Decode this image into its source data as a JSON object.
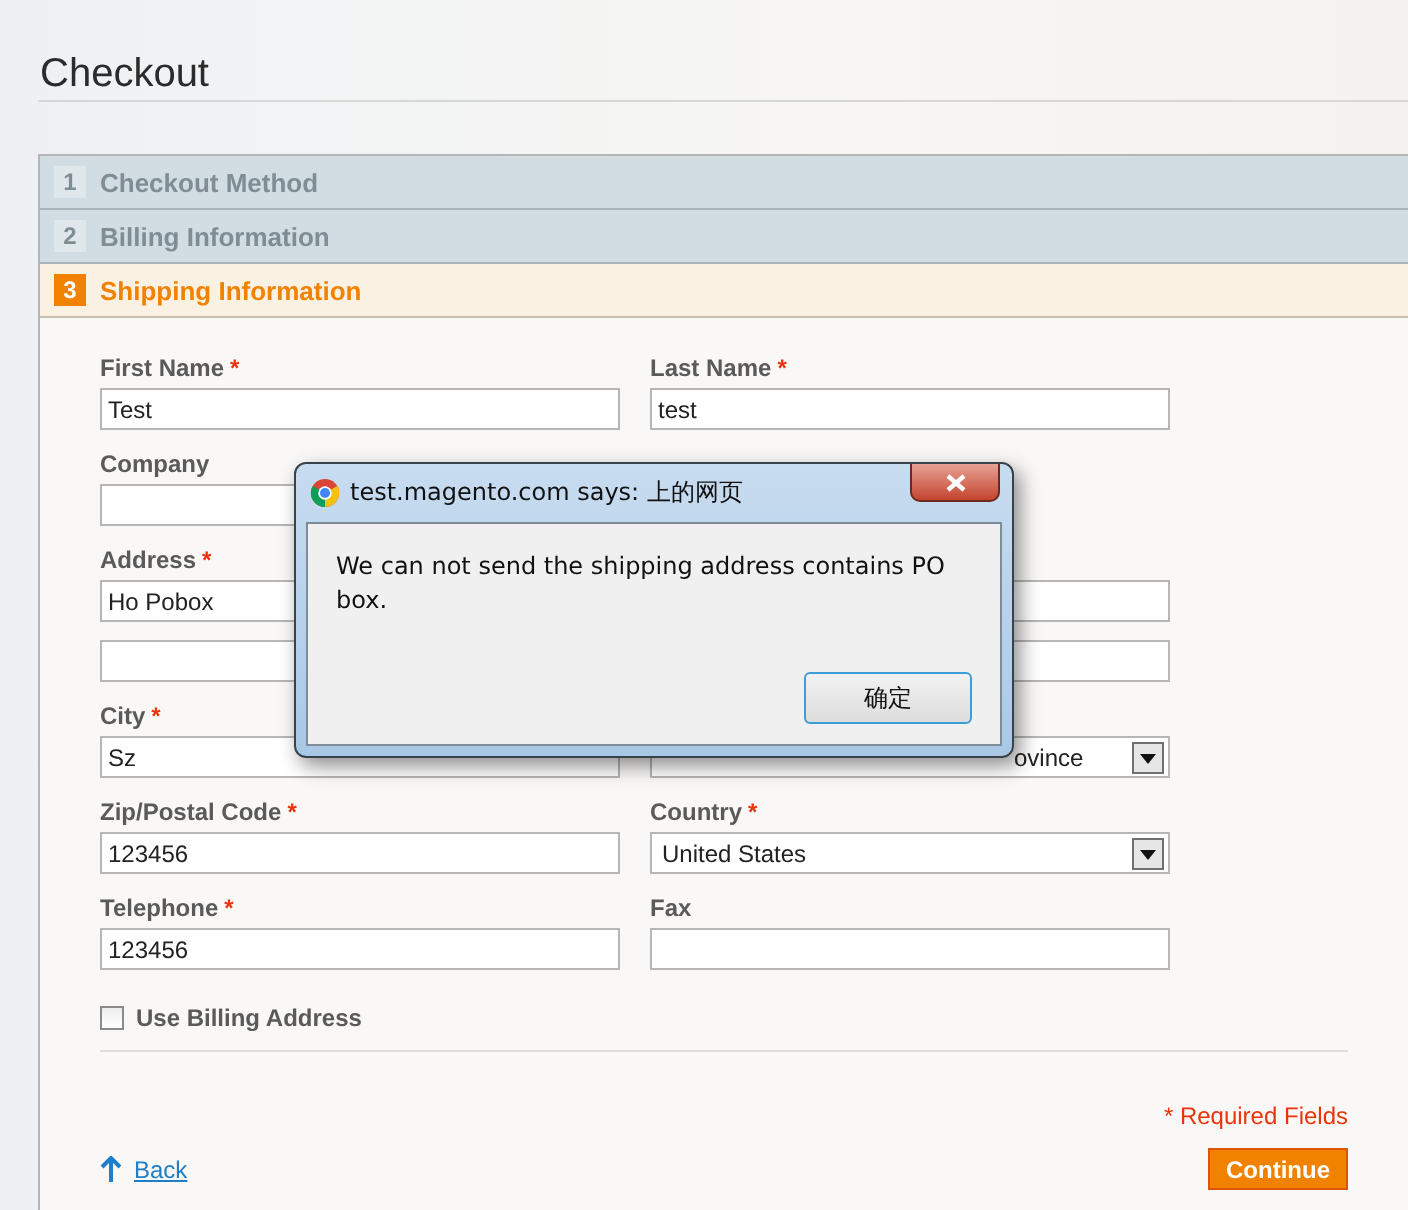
{
  "page": {
    "title": "Checkout"
  },
  "steps": [
    {
      "number": "1",
      "title": "Checkout Method",
      "selected": false
    },
    {
      "number": "2",
      "title": "Billing Information",
      "selected": false
    },
    {
      "number": "3",
      "title": "Shipping Information",
      "selected": true
    }
  ],
  "form": {
    "fields": [
      {
        "kind": "text",
        "label": "First Name",
        "required_mark": "*",
        "value": "Test"
      },
      {
        "kind": "text",
        "label": "Last Name",
        "required_mark": "*",
        "value": "test"
      },
      {
        "kind": "text",
        "label": "Company"
      },
      {
        "kind": "address",
        "label": "Address",
        "required_mark": "*",
        "value": "Ho Pobox"
      },
      {
        "kind": "text",
        "label": "City",
        "required_mark": "*",
        "value": "Sz"
      },
      {
        "kind": "select",
        "value": "ovince"
      },
      {
        "kind": "text",
        "label": "Zip/Postal Code",
        "required_mark": "*",
        "value": "123456"
      },
      {
        "kind": "select",
        "label": "Country",
        "required_mark": "*",
        "value": "United States"
      },
      {
        "kind": "text",
        "label": "Telephone",
        "required_mark": "*",
        "value": "123456"
      },
      {
        "kind": "text",
        "label": "Fax"
      }
    ],
    "use_billing_address": {
      "label": "Use Billing Address",
      "checked": false
    },
    "required_note": "* Required Fields",
    "back_link": "Back",
    "continue_button": "Continue"
  },
  "dialog": {
    "title": "test.magento.com says: 上的网页",
    "message": "We can not send the shipping address contains PO box.",
    "ok_button": "确定"
  }
}
